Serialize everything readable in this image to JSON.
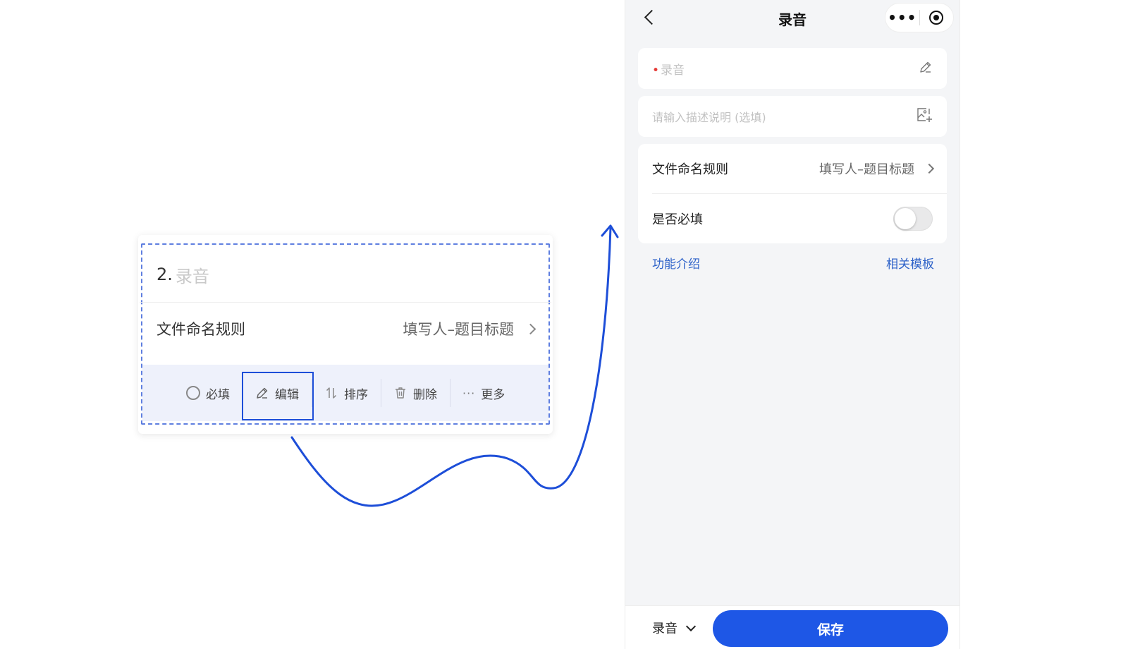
{
  "left_card": {
    "question_number": "2.",
    "question_title": "录音",
    "rule_label": "文件命名规则",
    "rule_value": "填写人–题目标题",
    "toolbar": {
      "required": "必填",
      "edit": "编辑",
      "sort": "排序",
      "delete": "删除",
      "more": "更多"
    }
  },
  "phone": {
    "nav_title": "录音",
    "capsule_more": "•••",
    "title_field": {
      "required_mark": "•",
      "placeholder": "录音"
    },
    "description_field": {
      "placeholder": "请输入描述说明 (选填)"
    },
    "settings": {
      "naming_rule_label": "文件命名规则",
      "naming_rule_value": "填写人–题目标题",
      "required_label": "是否必填",
      "required_enabled": false
    },
    "links": {
      "intro": "功能介绍",
      "templates": "相关模板"
    },
    "bottom": {
      "type_label": "录音",
      "save_label": "保存"
    }
  },
  "colors": {
    "accent_blue": "#1e57e6",
    "link_blue": "#2f63c9",
    "dashed_border": "#5f7fe0",
    "arrow_blue": "#1d4ed8",
    "required_red": "#e53935"
  }
}
